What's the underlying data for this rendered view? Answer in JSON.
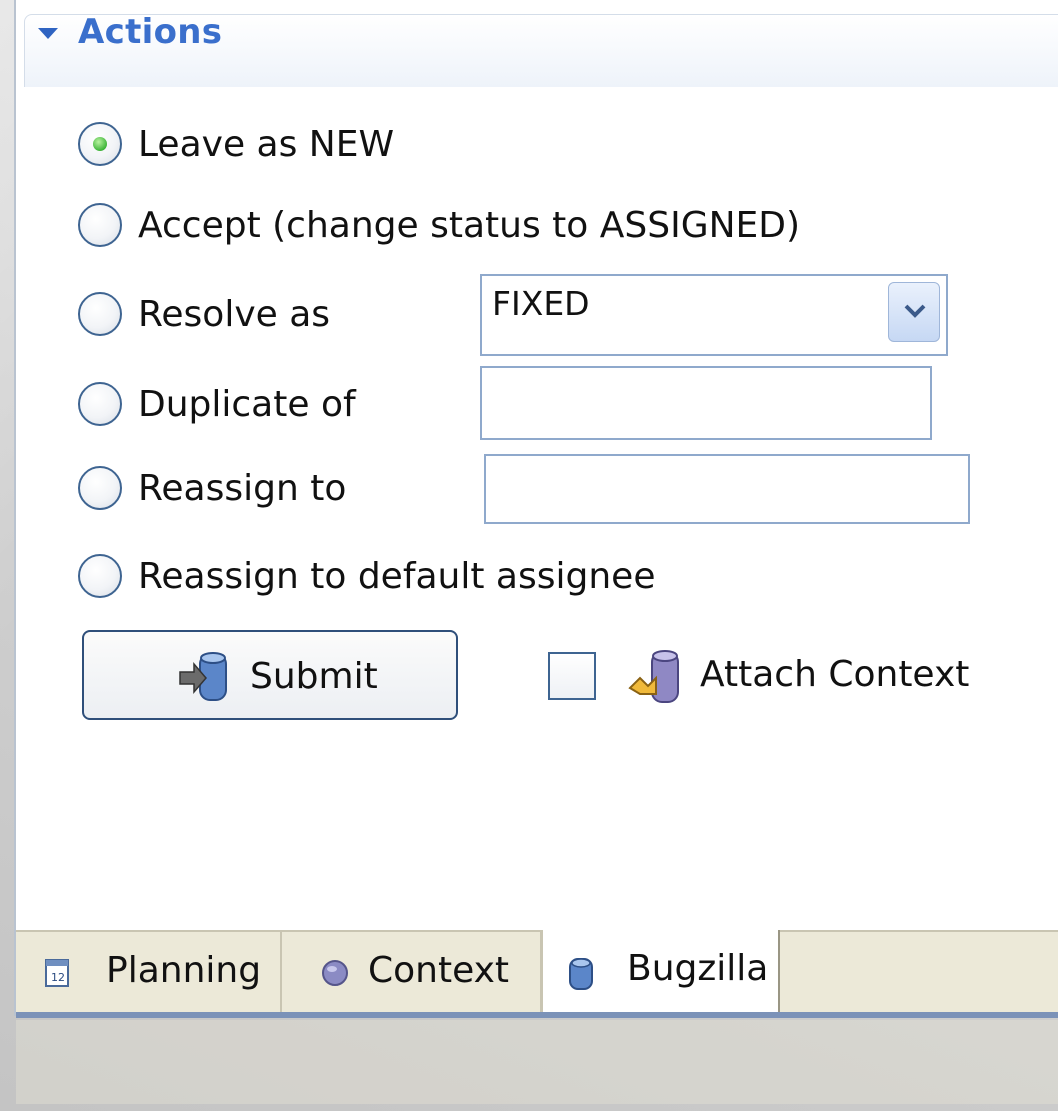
{
  "section": {
    "title": "Actions"
  },
  "options": [
    {
      "label": "Leave as NEW",
      "selected": true
    },
    {
      "label": "Accept (change status to ASSIGNED)",
      "selected": false
    },
    {
      "label": "Resolve as",
      "selected": false
    },
    {
      "label": "Duplicate of",
      "selected": false
    },
    {
      "label": "Reassign to",
      "selected": false
    },
    {
      "label": "Reassign to default assignee",
      "selected": false
    }
  ],
  "resolve_select": {
    "value": "FIXED"
  },
  "duplicate_input": {
    "value": ""
  },
  "reassign_input": {
    "value": ""
  },
  "submit": {
    "label": "Submit"
  },
  "attach_context": {
    "label": "Attach Context",
    "checked": false
  },
  "tabs": [
    {
      "label": "Planning",
      "icon": "planning-icon",
      "active": false
    },
    {
      "label": "Context",
      "icon": "context-icon",
      "active": false
    },
    {
      "label": "Bugzilla",
      "icon": "bugzilla-icon",
      "active": true
    }
  ],
  "colors": {
    "accent": "#3a6fcc",
    "radio_selected": "#3fb53a",
    "tabbar": "#ece9d8"
  }
}
